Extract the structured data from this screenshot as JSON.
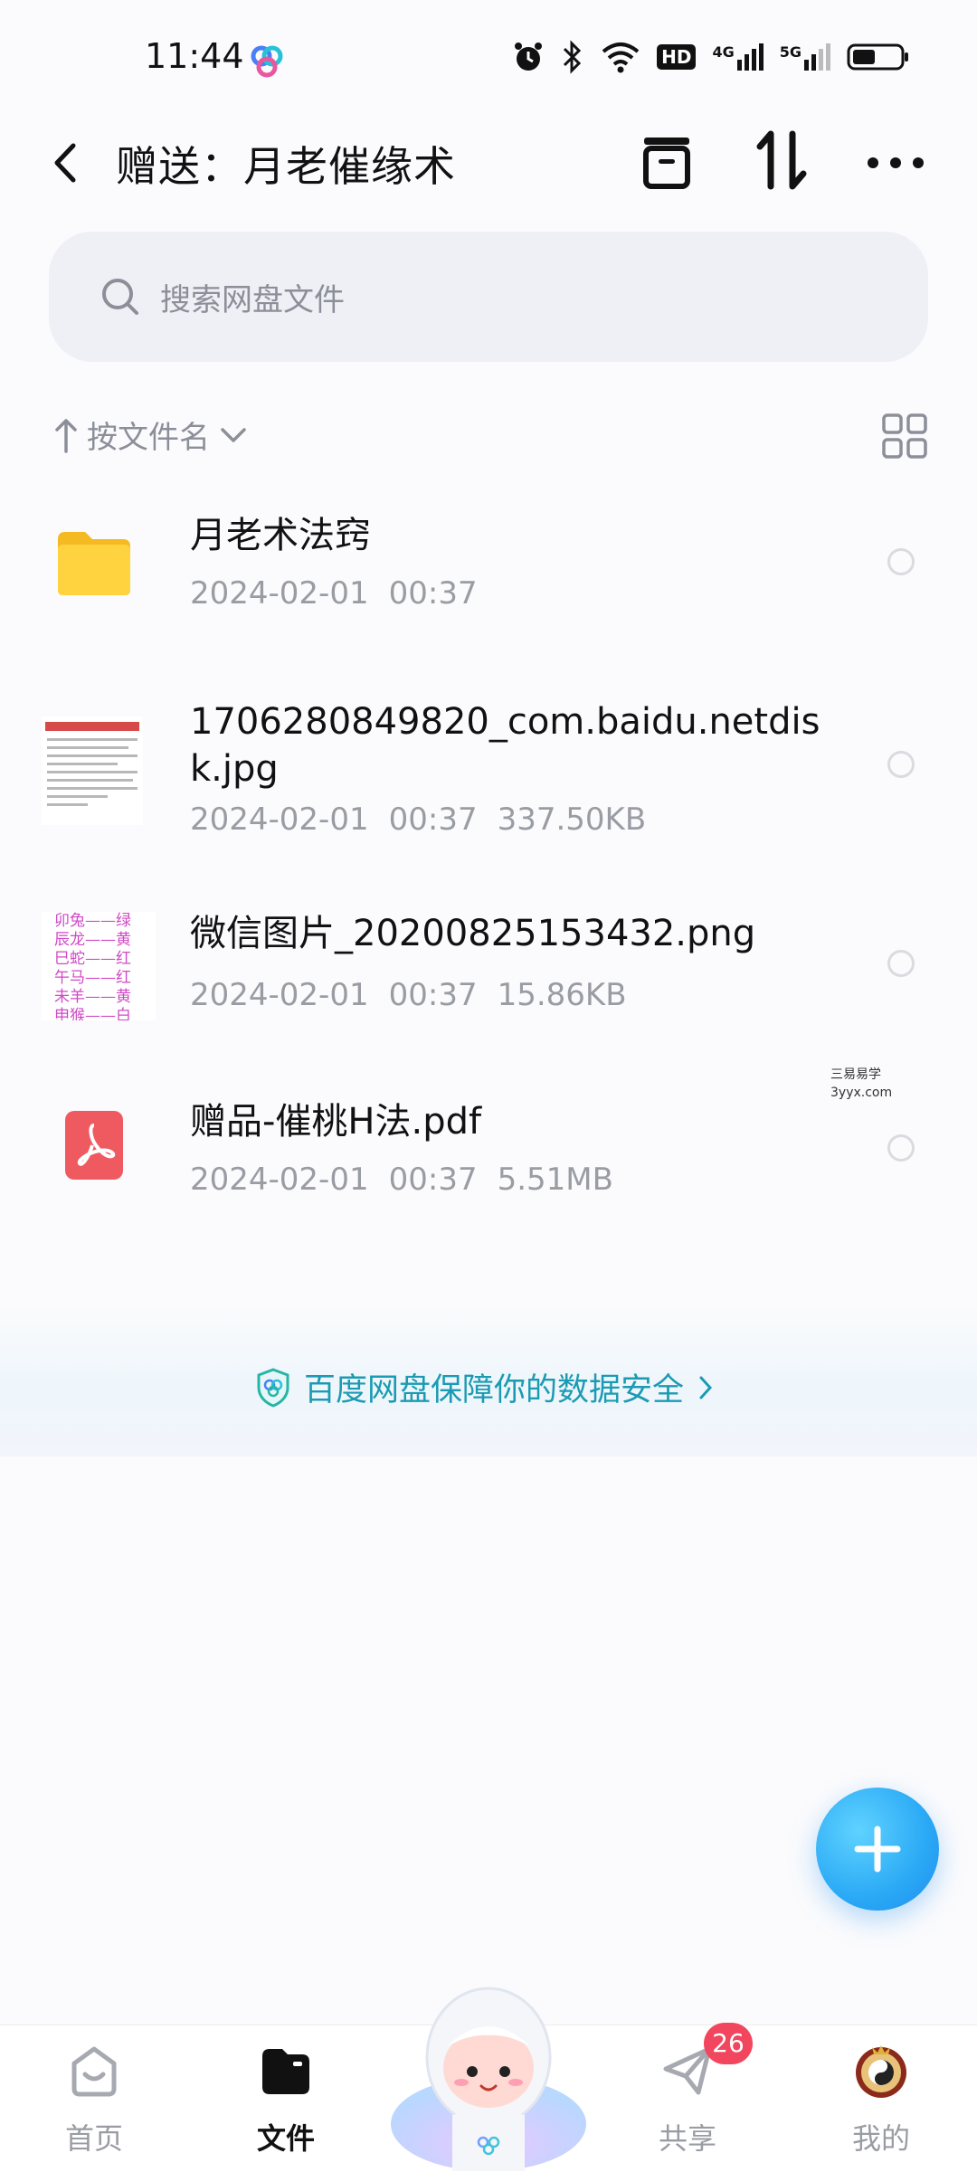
{
  "status_bar": {
    "time": "11:44",
    "icons": [
      "alarm-icon",
      "bluetooth-icon",
      "wifi-icon",
      "hd-voice-icon",
      "signal-4g-icon",
      "signal-5g-icon",
      "battery-icon"
    ],
    "hd_text": "HD",
    "net1": "4G",
    "net2": "5G"
  },
  "header": {
    "title": "赠送：月老催缘术",
    "icons": [
      "back-arrow-icon",
      "archive-box-icon",
      "sort-arrows-icon",
      "more-dots-icon"
    ]
  },
  "search": {
    "placeholder": "搜索网盘文件"
  },
  "sort": {
    "label": "按文件名"
  },
  "files": [
    {
      "name": "月老术法窍",
      "date": "2024-02-01",
      "time": "00:37",
      "size": "",
      "type": "folder"
    },
    {
      "name": "1706280849820_com.baidu.netdisk.jpg",
      "date": "2024-02-01",
      "time": "00:37",
      "size": "337.50KB",
      "type": "image"
    },
    {
      "name": "微信图片_20200825153432.png",
      "date": "2024-02-01",
      "time": "00:37",
      "size": "15.86KB",
      "type": "image"
    },
    {
      "name": "赠品-催桃H法.pdf",
      "date": "2024-02-01",
      "time": "00:37",
      "size": "5.51MB",
      "type": "pdf"
    }
  ],
  "thumb_poem_lines": [
    "卯兔——绿",
    "辰龙——黄",
    "巳蛇——红",
    "午马——红",
    "未羊——黄",
    "申猴——白"
  ],
  "watermark": {
    "line1": "三易易学",
    "line2": "3yyx.com"
  },
  "security_banner": {
    "text": "百度网盘保障你的数据安全"
  },
  "fab": {
    "icon": "plus-icon"
  },
  "bottom_nav": {
    "items": [
      {
        "label": "首页",
        "icon": "home-icon",
        "active": false
      },
      {
        "label": "文件",
        "icon": "folder-icon",
        "active": true
      },
      {
        "label": "共享",
        "icon": "share-plane-icon",
        "active": false
      },
      {
        "label": "我的",
        "icon": "profile-avatar-icon",
        "active": false
      }
    ],
    "badge_count": "26"
  },
  "colors": {
    "accent": "#1b9bb3",
    "fab": "#2aa9f5",
    "badge": "#f2465e",
    "folder": "#ffcc33",
    "pdf": "#ee5a60"
  }
}
